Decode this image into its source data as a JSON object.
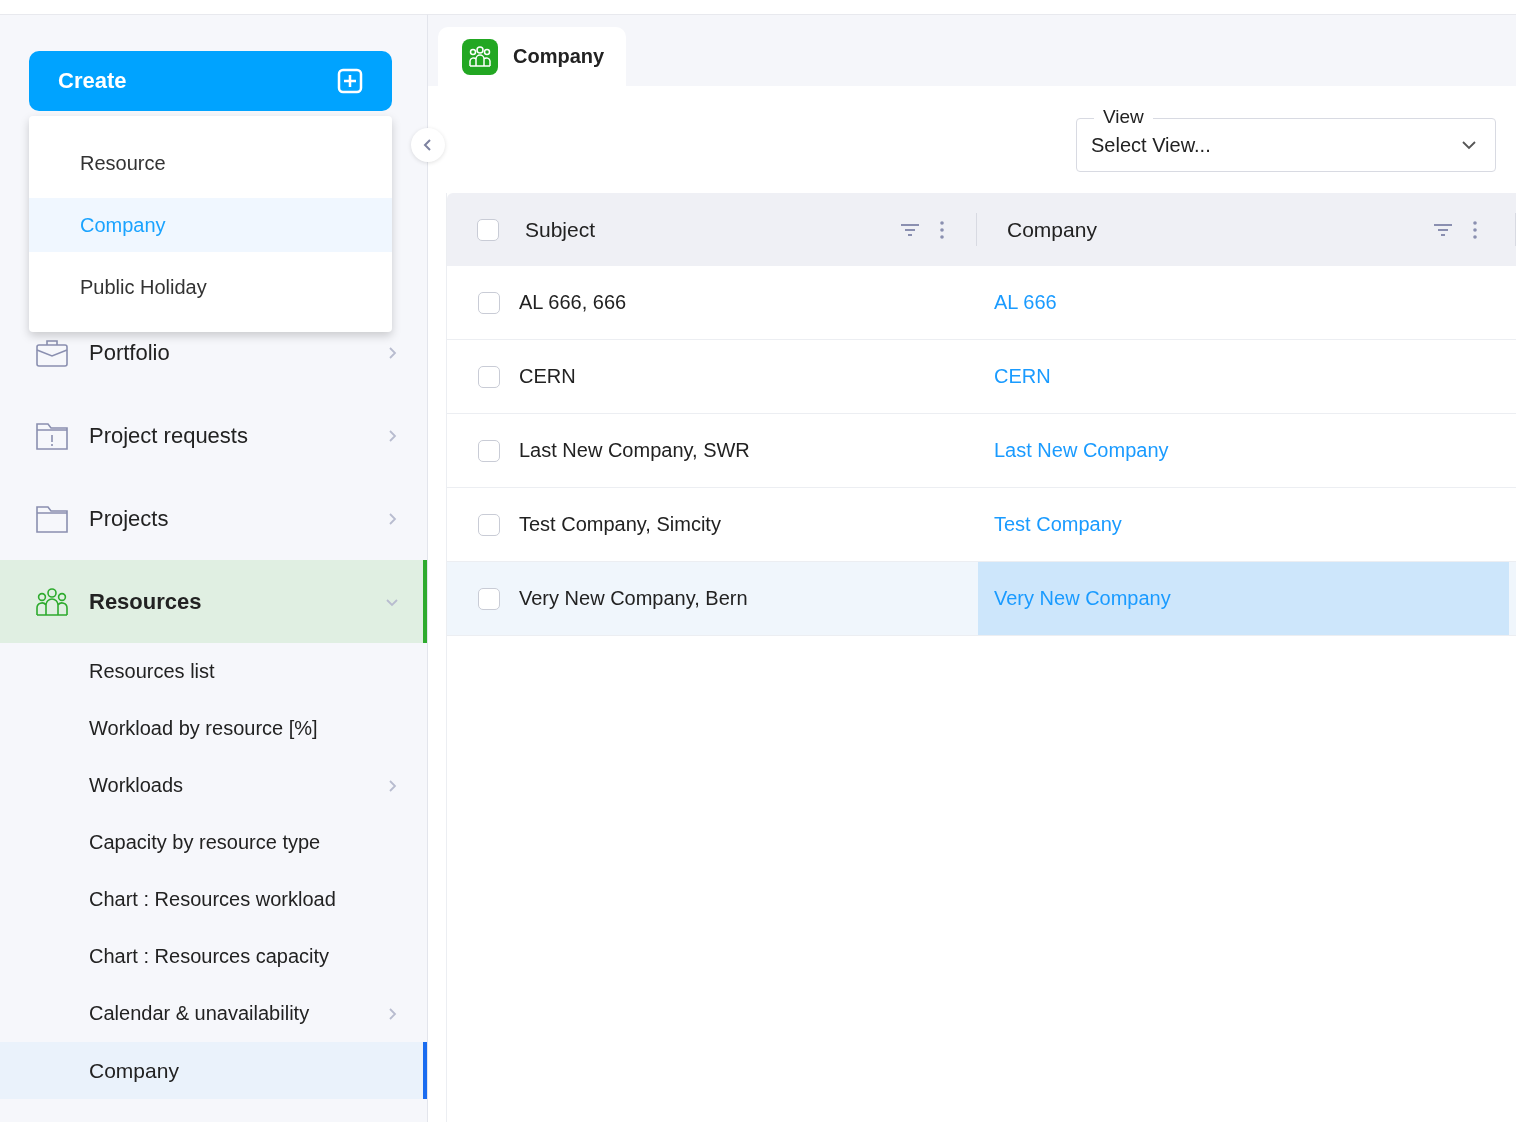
{
  "create": {
    "label": "Create"
  },
  "create_menu": [
    {
      "label": "Resource",
      "selected": false
    },
    {
      "label": "Company",
      "selected": true
    },
    {
      "label": "Public Holiday",
      "selected": false
    }
  ],
  "sidebar": {
    "items": [
      {
        "label": "Portfolio",
        "kind": "briefcase",
        "has_arrow": true,
        "expanded": false,
        "selected": false
      },
      {
        "label": "Project requests",
        "kind": "folder-alert",
        "has_arrow": true,
        "expanded": false,
        "selected": false
      },
      {
        "label": "Projects",
        "kind": "folder",
        "has_arrow": true,
        "expanded": false,
        "selected": false
      },
      {
        "label": "Resources",
        "kind": "people",
        "has_arrow": true,
        "expanded": true,
        "selected": true,
        "children": [
          {
            "label": "Resources list",
            "has_arrow": false,
            "selected": false
          },
          {
            "label": "Workload by resource [%]",
            "has_arrow": false,
            "selected": false
          },
          {
            "label": "Workloads",
            "has_arrow": true,
            "selected": false
          },
          {
            "label": "Capacity by resource type",
            "has_arrow": false,
            "selected": false
          },
          {
            "label": "Chart : Resources workload",
            "has_arrow": false,
            "selected": false
          },
          {
            "label": "Chart : Resources capacity",
            "has_arrow": false,
            "selected": false
          },
          {
            "label": "Calendar & unavailability",
            "has_arrow": true,
            "selected": false
          },
          {
            "label": "Company",
            "has_arrow": false,
            "selected": true
          }
        ]
      }
    ]
  },
  "tab": {
    "title": "Company"
  },
  "view_select": {
    "label": "View",
    "value": "Select View..."
  },
  "table": {
    "all_checked": false,
    "columns": [
      {
        "label": "Subject"
      },
      {
        "label": "Company"
      }
    ],
    "rows": [
      {
        "subject": "AL 666, 666",
        "company": "AL 666",
        "checked": false,
        "selected": false
      },
      {
        "subject": "CERN",
        "company": "CERN",
        "checked": false,
        "selected": false
      },
      {
        "subject": "Last New Company, SWR",
        "company": "Last New Company",
        "checked": false,
        "selected": false
      },
      {
        "subject": "Test Company, Simcity",
        "company": "Test Company",
        "checked": false,
        "selected": false
      },
      {
        "subject": "Very New Company, Bern",
        "company": "Very New Company",
        "checked": false,
        "selected": true
      }
    ]
  }
}
